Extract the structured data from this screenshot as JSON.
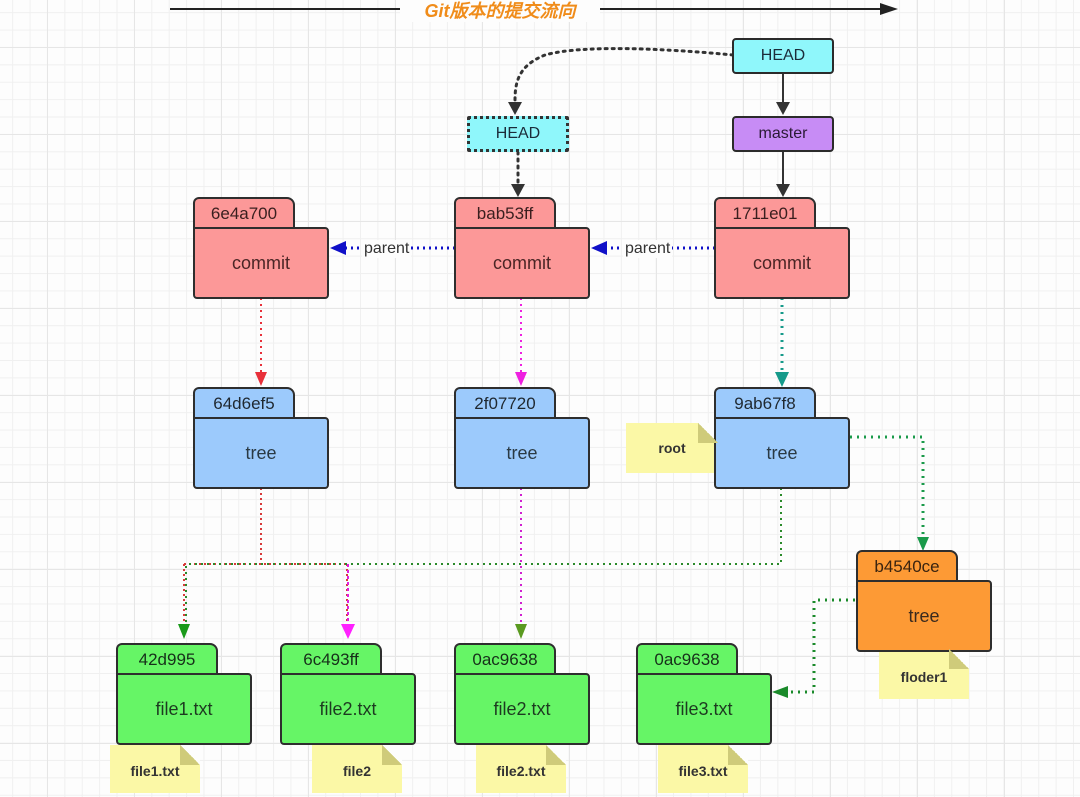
{
  "title": "Git版本的提交流向",
  "refs": {
    "head_current": "HEAD",
    "head_previous": "HEAD",
    "branch": "master"
  },
  "edge_labels": {
    "parent_1": "parent",
    "parent_2": "parent"
  },
  "commits": [
    {
      "hash": "6e4a700",
      "type": "commit"
    },
    {
      "hash": "bab53ff",
      "type": "commit"
    },
    {
      "hash": "1711e01",
      "type": "commit"
    }
  ],
  "trees": [
    {
      "hash": "64d6ef5",
      "type": "tree"
    },
    {
      "hash": "2f07720",
      "type": "tree"
    },
    {
      "hash": "9ab67f8",
      "type": "tree",
      "note": "root"
    },
    {
      "hash": "b4540ce",
      "type": "tree",
      "note": "floder1"
    }
  ],
  "blobs": [
    {
      "hash": "42d995",
      "type": "file1.txt",
      "note": "file1.txt"
    },
    {
      "hash": "6c493ff",
      "type": "file2.txt",
      "note": "file2"
    },
    {
      "hash": "0ac9638",
      "type": "file2.txt",
      "note": "file2.txt"
    },
    {
      "hash": "0ac9638",
      "type": "file3.txt",
      "note": "file3.txt"
    }
  ],
  "colors": {
    "title": "#f08c1a",
    "commit": "#fc9898",
    "tree": "#9ccafc",
    "subtree": "#fd9a35",
    "blob": "#66f566",
    "head": "#8ff7fb",
    "branch": "#c78cf5",
    "note": "#fbf8a6",
    "parent_edge": "#1010c8"
  }
}
